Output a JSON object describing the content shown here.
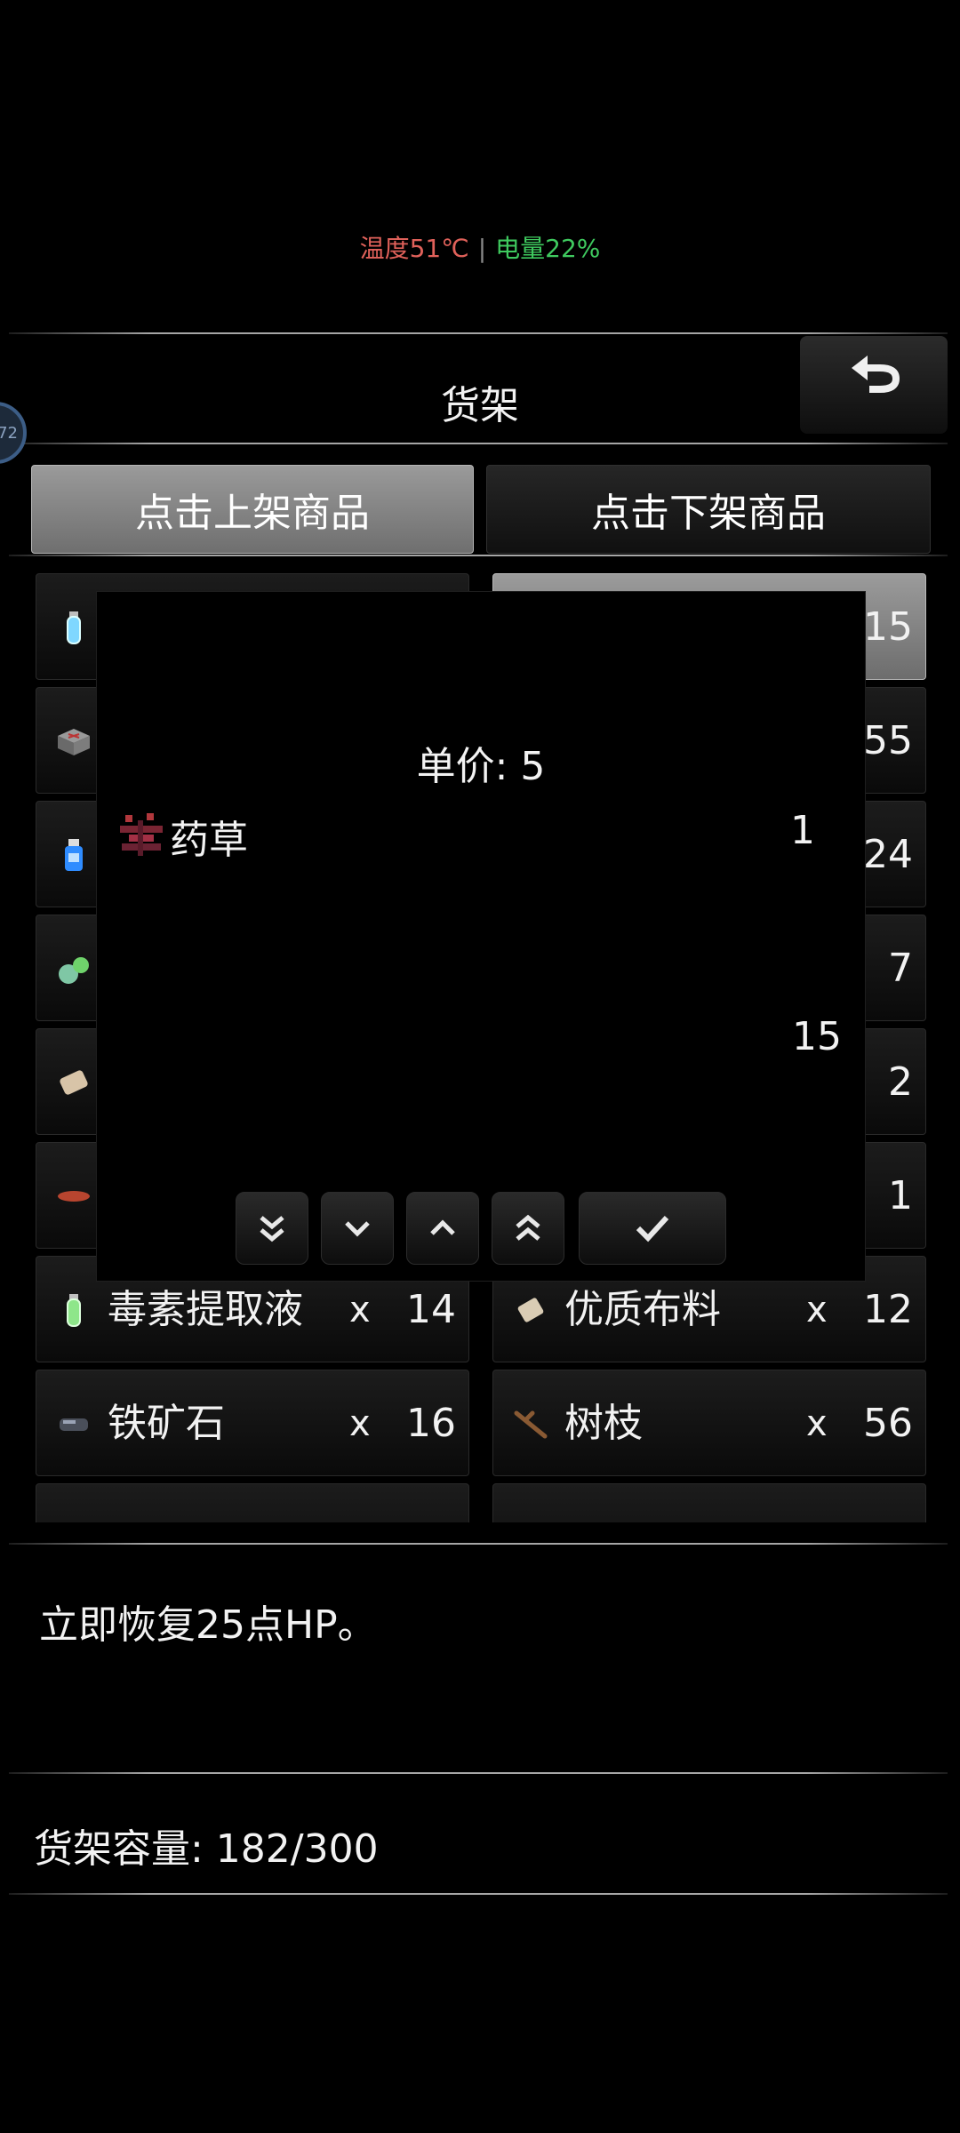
{
  "status": {
    "temperature": "温度51℃",
    "separator": "|",
    "battery": "电量22%"
  },
  "header": {
    "title": "货架",
    "back_icon": "undo-arrow-icon",
    "float_icon": "assistant-bubble-icon",
    "float_text": "72"
  },
  "tabs": [
    {
      "label": "点击上架商品",
      "active": true
    },
    {
      "label": "点击下架商品",
      "active": false
    }
  ],
  "left_items": [
    {
      "icon": "potion-vial-icon",
      "name": "",
      "x": "",
      "qty": ""
    },
    {
      "icon": "ore-block-icon",
      "name": "",
      "x": "",
      "qty": ""
    },
    {
      "icon": "spray-bottle-icon",
      "name": "",
      "x": "",
      "qty": ""
    },
    {
      "icon": "green-crystal-icon",
      "name": "",
      "x": "",
      "qty": ""
    },
    {
      "icon": "bandage-icon",
      "name": "",
      "x": "",
      "qty": ""
    },
    {
      "icon": "red-leaf-icon",
      "name": "",
      "x": "",
      "qty": ""
    },
    {
      "icon": "potion-vial-icon",
      "name": "毒素提取液",
      "x": "x",
      "qty": "14"
    },
    {
      "icon": "iron-ore-icon",
      "name": "铁矿石",
      "x": "x",
      "qty": "16"
    }
  ],
  "right_items": [
    {
      "icon": "",
      "name": "",
      "x": "",
      "qty": "15"
    },
    {
      "icon": "",
      "name": "",
      "x": "",
      "qty": "55"
    },
    {
      "icon": "",
      "name": "",
      "x": "",
      "qty": "24"
    },
    {
      "icon": "",
      "name": "",
      "x": "",
      "qty": "7"
    },
    {
      "icon": "",
      "name": "",
      "x": "",
      "qty": "2"
    },
    {
      "icon": "",
      "name": "",
      "x": "",
      "qty": "1"
    },
    {
      "icon": "cloth-icon",
      "name": "优质布料",
      "x": "x",
      "qty": "12"
    },
    {
      "icon": "branch-icon",
      "name": "树枝",
      "x": "x",
      "qty": "56"
    }
  ],
  "dialog": {
    "unit_price": "单价: 5",
    "item_icon": "herb-icon",
    "item_name": "药草",
    "quantity": "1",
    "total": "15",
    "buttons": [
      "double-chevron-down-icon",
      "chevron-down-icon",
      "chevron-up-icon",
      "double-chevron-up-icon",
      "checkmark-icon"
    ]
  },
  "description": "立即恢复25点HP。",
  "capacity": "货架容量: 182/300",
  "colors": {
    "temperature": "#e0615a",
    "battery": "#3fca5f",
    "active_tab": "#8a8a8a"
  }
}
